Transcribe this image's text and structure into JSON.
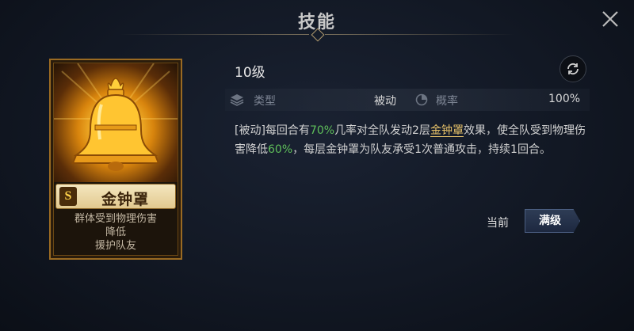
{
  "header": {
    "title": "技能"
  },
  "skill": {
    "rarity": "S",
    "name": "金钟罩",
    "card_desc_lines": [
      "群体受到物理伤害",
      "降低",
      "援护队友"
    ],
    "level": "10级",
    "type_label": "类型",
    "type_value": "被动",
    "chance_label": "概率",
    "chance_value": "100%",
    "description": {
      "p1": "[被动]每回合有",
      "v1": "70%",
      "p2": "几率对全队发动2层",
      "name_link": "金钟罩",
      "p3": "效果，使全队受到物理伤害降低",
      "v2": "60%",
      "p4": "，每层金钟罩为队友承受1次普通攻击，持续1回合。"
    }
  },
  "actions": {
    "current_label": "当前",
    "max_label": "满级"
  },
  "icons": {
    "close": "close-icon",
    "refresh": "refresh-icon",
    "type": "layers-icon",
    "chance": "pie-icon",
    "art": "golden-bell-icon"
  },
  "colors": {
    "highlight_green": "#5fbf5a",
    "highlight_gold": "#e9c36a",
    "card_gold": "#9a6a22"
  }
}
